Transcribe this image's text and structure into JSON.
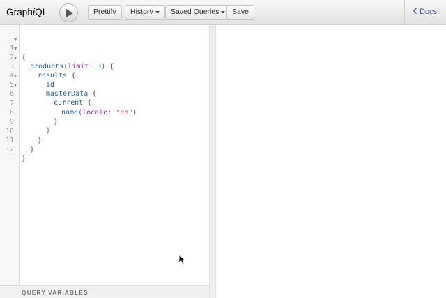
{
  "app": {
    "title_prefix": "Graph",
    "title_italic": "i",
    "title_suffix": "QL"
  },
  "toolbar": {
    "execute_icon": "play-icon",
    "prettify_label": "Prettify",
    "history_label": "History",
    "saved_queries_label": "Saved Queries",
    "save_label": "Save"
  },
  "docs": {
    "icon": "chevron-left-icon",
    "label": "Docs"
  },
  "editor": {
    "lines": [
      {
        "num": "1",
        "fold": true
      },
      {
        "num": "2",
        "fold": true
      },
      {
        "num": "3",
        "fold": true
      },
      {
        "num": "4",
        "fold": false
      },
      {
        "num": "5",
        "fold": true
      },
      {
        "num": "6",
        "fold": true
      },
      {
        "num": "7",
        "fold": false
      },
      {
        "num": "8",
        "fold": false
      },
      {
        "num": "9",
        "fold": false
      },
      {
        "num": "10",
        "fold": false
      },
      {
        "num": "11",
        "fold": false
      },
      {
        "num": "12",
        "fold": false
      }
    ],
    "tokens": {
      "open_brace": "{",
      "close_brace": "}",
      "products": "products",
      "limit": "limit",
      "limit_value": "3",
      "results": "results",
      "id": "id",
      "masterData": "masterData",
      "current": "current",
      "name": "name",
      "locale": "locale",
      "locale_value": "\"en\""
    }
  },
  "query_variables": {
    "label": "QUERY VARIABLES"
  },
  "colors": {
    "field": "#1f61a0",
    "argument": "#8b2bb9",
    "number": "#2882f9",
    "string": "#d64292",
    "docs_link": "#3b5998"
  }
}
